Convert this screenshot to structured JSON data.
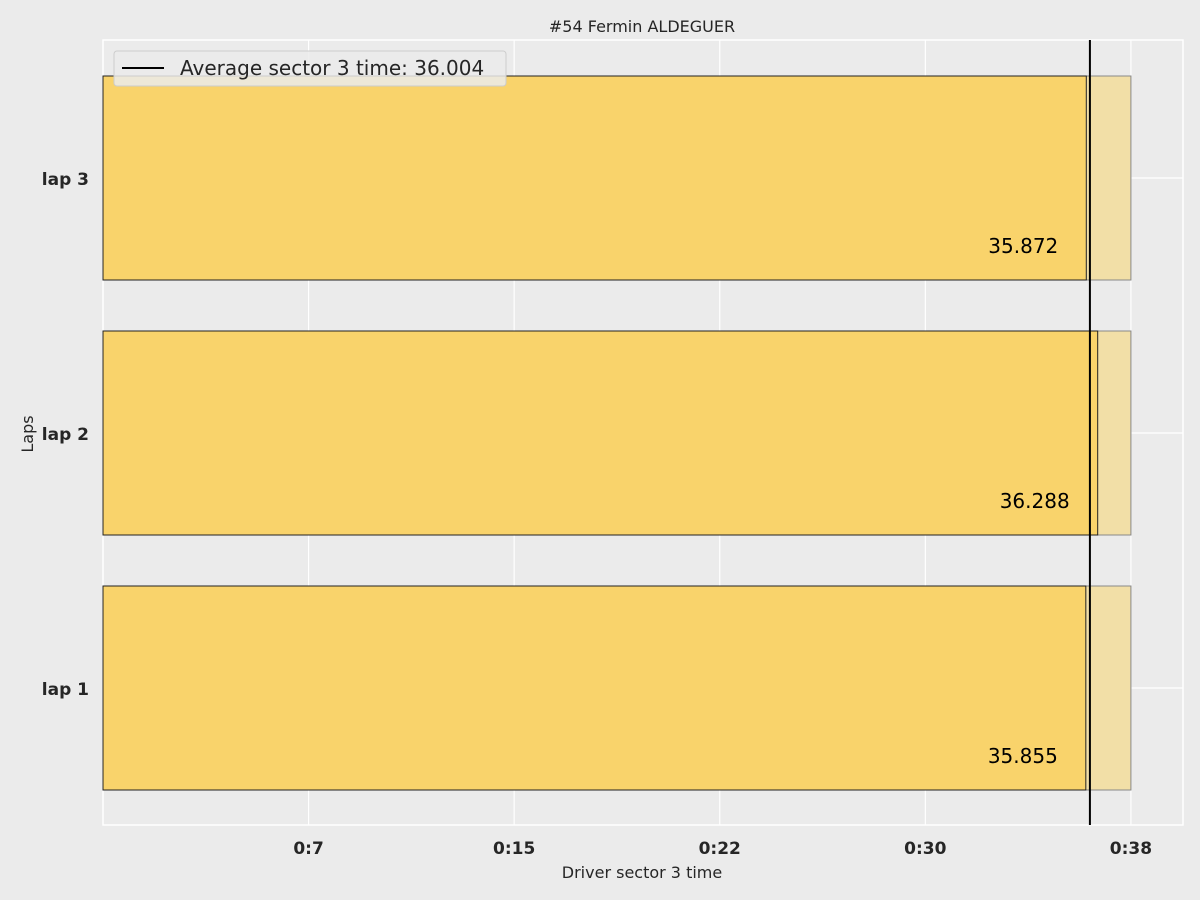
{
  "chart_data": {
    "type": "bar",
    "orientation": "horizontal",
    "title": "#54  Fermin ALDEGUER",
    "xlabel": "Driver sector 3 time",
    "ylabel": "Laps",
    "categories": [
      "lap 1",
      "lap 2",
      "lap 3"
    ],
    "values": [
      35.855,
      36.288,
      35.872
    ],
    "value_labels": [
      "35.855",
      "36.288",
      "35.872"
    ],
    "background_bar_value": 37.5,
    "average": 36.004,
    "legend": {
      "label": "Average sector 3 time: 36.004",
      "placement": "top-left"
    },
    "x_ticks": [
      {
        "value": 7.5,
        "label": "0:7"
      },
      {
        "value": 15,
        "label": "0:15"
      },
      {
        "value": 22.5,
        "label": "0:22"
      },
      {
        "value": 30,
        "label": "0:30"
      },
      {
        "value": 37.5,
        "label": "0:38"
      }
    ],
    "xlim": [
      0,
      39.4
    ],
    "grid": true,
    "colors": {
      "background": "#ebebeb",
      "bar": "#f9d36b",
      "background_bar": "#f2dfa7",
      "average_line": "#000000",
      "grid": "#ffffff"
    }
  }
}
